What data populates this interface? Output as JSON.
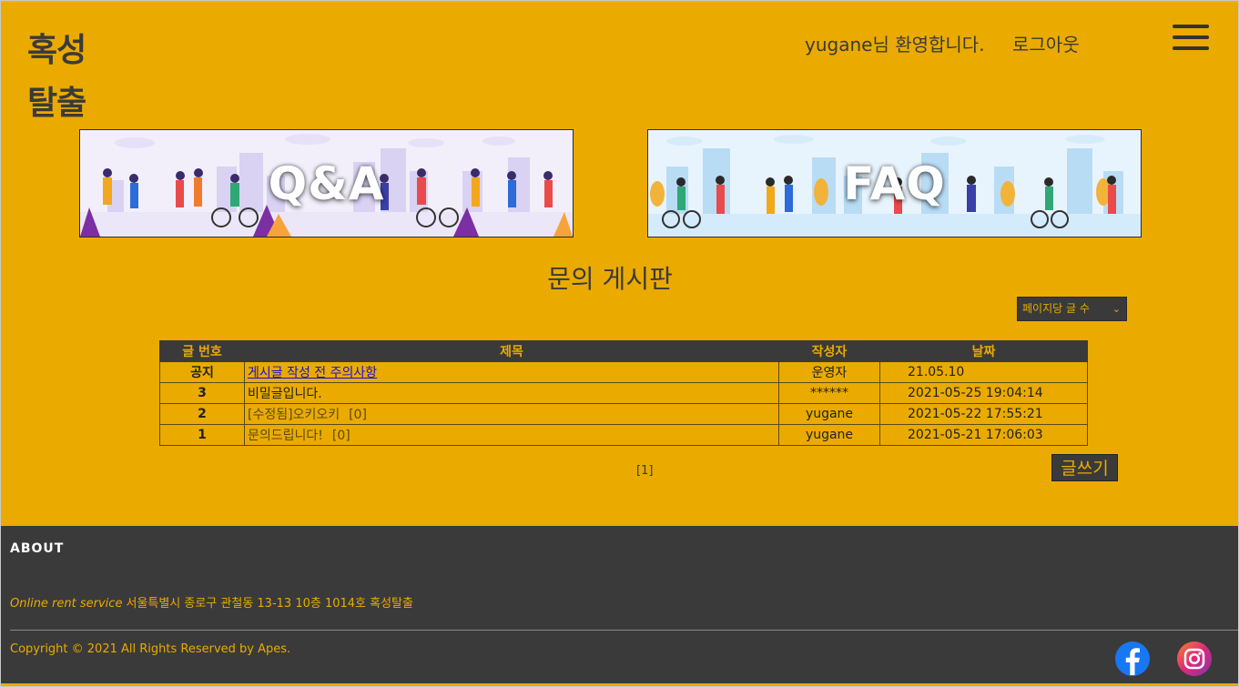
{
  "header": {
    "logo_line1": "혹성",
    "logo_line2": "탈출",
    "welcome": "yugane님 환영합니다.",
    "logout": "로그아웃"
  },
  "banners": {
    "qa_label": "Q&A",
    "faq_label": "FAQ"
  },
  "board": {
    "title": "문의 게시판",
    "per_page_select": "페이지당 글 수",
    "columns": [
      "글 번호",
      "제목",
      "작성자",
      "날짜"
    ],
    "rows": [
      {
        "num": "공지",
        "title": "게시글 작성 전 주의사항",
        "comments": "",
        "author": "운영자",
        "date": "21.05.10"
      },
      {
        "num": "3",
        "title": "비밀글입니다.",
        "comments": "",
        "author": "******",
        "date": "2021-05-25 19:04:14"
      },
      {
        "num": "2",
        "title": "[수정됨]오키오키",
        "comments": "[0]",
        "author": "yugane",
        "date": "2021-05-22 17:55:21"
      },
      {
        "num": "1",
        "title": "문의드립니다!",
        "comments": "[0]",
        "author": "yugane",
        "date": "2021-05-21 17:06:03"
      }
    ],
    "pagination": "[1]",
    "write_button": "글쓰기"
  },
  "footer": {
    "about": "ABOUT",
    "service": "Online rent service",
    "address": "서울특별시 종로구 관철동 13-13 10층 1014호 혹성탈출",
    "copyright": "Copyright © 2021 All Rights Reserved by Apes."
  },
  "colors": {
    "background": "#EAAA00",
    "dark": "#3a3a3a",
    "facebook": "#1877F2"
  },
  "icons": [
    "hamburger-menu-icon",
    "facebook-icon",
    "instagram-icon"
  ]
}
